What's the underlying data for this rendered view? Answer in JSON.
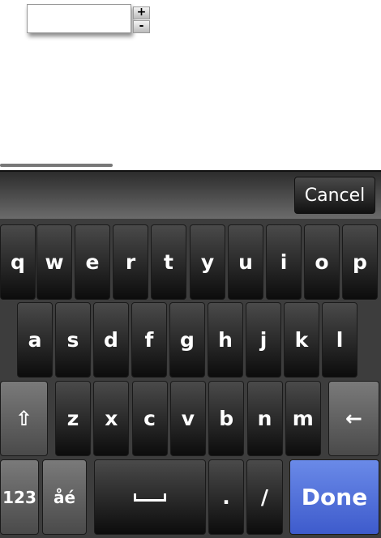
{
  "stepper": {
    "increment": "+",
    "decrement": "-"
  },
  "candidate_bar": {
    "cancel": "Cancel"
  },
  "keyboard": {
    "row1": [
      "q",
      "w",
      "e",
      "r",
      "t",
      "y",
      "u",
      "i",
      "o",
      "p"
    ],
    "row2": [
      "a",
      "s",
      "d",
      "f",
      "g",
      "h",
      "j",
      "k",
      "l"
    ],
    "row3": [
      "z",
      "x",
      "c",
      "v",
      "b",
      "n",
      "m"
    ],
    "shift": "⇧",
    "backspace": "←",
    "numbers": "123",
    "accents": "åé",
    "period": ".",
    "slash": "/",
    "done": "Done"
  },
  "colors": {
    "done": "#4f6fdc"
  }
}
